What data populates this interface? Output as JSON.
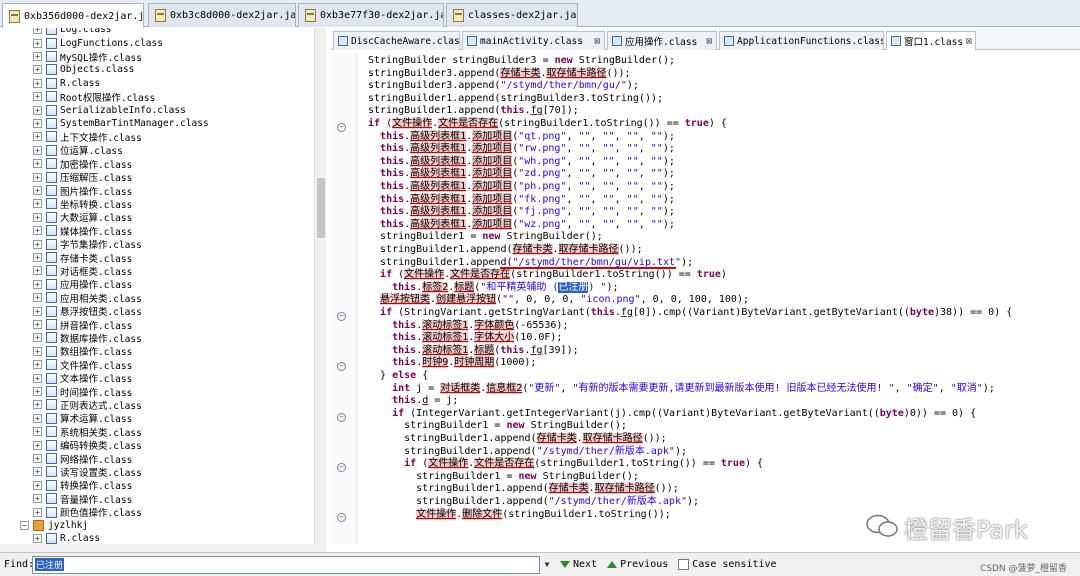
{
  "top_tabs": [
    {
      "label": "0xb356d000-dex2jar.jar",
      "active": true
    },
    {
      "label": "0xb3c8d000-dex2jar.jar",
      "active": false
    },
    {
      "label": "0xb3e77f30-dex2jar.jar",
      "active": false
    },
    {
      "label": "classes-dex2jar.jar",
      "active": false
    }
  ],
  "tree": {
    "items": [
      {
        "label": "Log.class",
        "type": "class",
        "indent": 1
      },
      {
        "label": "LogFunctions.class",
        "type": "class",
        "indent": 1
      },
      {
        "label": "MySQL操作.class",
        "type": "class",
        "indent": 1
      },
      {
        "label": "Objects.class",
        "type": "class",
        "indent": 1
      },
      {
        "label": "R.class",
        "type": "class",
        "indent": 1
      },
      {
        "label": "Root权限操作.class",
        "type": "class",
        "indent": 1
      },
      {
        "label": "SerializableInfo.class",
        "type": "class",
        "indent": 1
      },
      {
        "label": "SystemBarTintManager.class",
        "type": "class",
        "indent": 1
      },
      {
        "label": "上下文操作.class",
        "type": "class",
        "indent": 1
      },
      {
        "label": "位运算.class",
        "type": "class",
        "indent": 1
      },
      {
        "label": "加密操作.class",
        "type": "class",
        "indent": 1
      },
      {
        "label": "压缩解压.class",
        "type": "class",
        "indent": 1
      },
      {
        "label": "图片操作.class",
        "type": "class",
        "indent": 1
      },
      {
        "label": "坐标转换.class",
        "type": "class",
        "indent": 1
      },
      {
        "label": "大数运算.class",
        "type": "class",
        "indent": 1
      },
      {
        "label": "媒体操作.class",
        "type": "class",
        "indent": 1
      },
      {
        "label": "字节集操作.class",
        "type": "class",
        "indent": 1
      },
      {
        "label": "存储卡类.class",
        "type": "class",
        "indent": 1
      },
      {
        "label": "对话框类.class",
        "type": "class",
        "indent": 1
      },
      {
        "label": "应用操作.class",
        "type": "class",
        "indent": 1
      },
      {
        "label": "应用相关类.class",
        "type": "class",
        "indent": 1
      },
      {
        "label": "悬浮按钮类.class",
        "type": "class",
        "indent": 1
      },
      {
        "label": "拼音操作.class",
        "type": "class",
        "indent": 1
      },
      {
        "label": "数据库操作.class",
        "type": "class",
        "indent": 1
      },
      {
        "label": "数组操作.class",
        "type": "class",
        "indent": 1
      },
      {
        "label": "文件操作.class",
        "type": "class",
        "indent": 1
      },
      {
        "label": "文本操作.class",
        "type": "class",
        "indent": 1
      },
      {
        "label": "时间操作.class",
        "type": "class",
        "indent": 1
      },
      {
        "label": "正则表达式.class",
        "type": "class",
        "indent": 1
      },
      {
        "label": "算术运算.class",
        "type": "class",
        "indent": 1
      },
      {
        "label": "系统相关类.class",
        "type": "class",
        "indent": 1
      },
      {
        "label": "编码转换类.class",
        "type": "class",
        "indent": 1
      },
      {
        "label": "网络操作.class",
        "type": "class",
        "indent": 1
      },
      {
        "label": "读写设置类.class",
        "type": "class",
        "indent": 1
      },
      {
        "label": "转换操作.class",
        "type": "class",
        "indent": 1
      },
      {
        "label": "音量操作.class",
        "type": "class",
        "indent": 1
      },
      {
        "label": "颜色值操作.class",
        "type": "class",
        "indent": 1
      },
      {
        "label": "jyzlhkj",
        "type": "package",
        "indent": 0
      },
      {
        "label": "R.class",
        "type": "class",
        "indent": 1
      }
    ]
  },
  "editor_tabs": [
    {
      "label": "DiscCacheAware.class",
      "active": false
    },
    {
      "label": "mainActivity.class",
      "active": false
    },
    {
      "label": "应用操作.class",
      "active": false
    },
    {
      "label": "ApplicationFunctions.class",
      "active": false
    },
    {
      "label": "窗口1.class",
      "active": true
    }
  ],
  "code_lines": [
    "StringBuilder stringBuilder3 = new StringBuilder();",
    "stringBuilder3.append(存储卡类.取存储卡路径());",
    "stringBuilder3.append(\"/stymd/ther/bmn/gu/\");",
    "stringBuilder1.append(stringBuilder3.toString());",
    "stringBuilder1.append(this.fg[70]);",
    "if (文件操作.文件是否存在(stringBuilder1.toString()) == true) {",
    "  this.高级列表框1.添加项目(\"qt.png\", \"\", \"\", \"\", \"\");",
    "  this.高级列表框1.添加项目(\"rw.png\", \"\", \"\", \"\", \"\");",
    "  this.高级列表框1.添加项目(\"wh.png\", \"\", \"\", \"\", \"\");",
    "  this.高级列表框1.添加项目(\"zd.png\", \"\", \"\", \"\", \"\");",
    "  this.高级列表框1.添加项目(\"ph.png\", \"\", \"\", \"\", \"\");",
    "  this.高级列表框1.添加项目(\"fk.png\", \"\", \"\", \"\", \"\");",
    "  this.高级列表框1.添加项目(\"fj.png\", \"\", \"\", \"\", \"\");",
    "  this.高级列表框1.添加项目(\"wz.png\", \"\", \"\", \"\", \"\");",
    "  stringBuilder1 = new StringBuilder();",
    "  stringBuilder1.append(存储卡类.取存储卡路径());",
    "  stringBuilder1.append(\"/stymd/ther/bmn/gu/vip.txt\");",
    "  if (文件操作.文件是否存在(stringBuilder1.toString()) == true)",
    "    this.标签2.标题(\"和平精英辅助 (已注册) \");",
    "  悬浮按钮类.创建悬浮按钮(\"\", 0, 0, 0, \"icon.png\", 0, 0, 100, 100);",
    "  if (StringVariant.getStringVariant(this.fg[0]).cmp((Variant)ByteVariant.getByteVariant((byte)38)) == 0) {",
    "    this.滚动标签1.字体颜色(-65536);",
    "    this.滚动标签1.字体大小(10.0F);",
    "    this.滚动标签1.标题(this.fg[39]);",
    "    this.时钟9.时钟周期(1000);",
    "  } else {",
    "    int j = 对话框类.信息框2(\"更新\", \"有新的版本需要更新,请更新到最新版本使用! 旧版本已经无法使用! \", \"确定\", \"取消\");",
    "    this.d = j;",
    "    if (IntegerVariant.getIntegerVariant(j).cmp((Variant)ByteVariant.getByteVariant((byte)0)) == 0) {",
    "      stringBuilder1 = new StringBuilder();",
    "      stringBuilder1.append(存储卡类.取存储卡路径());",
    "      stringBuilder1.append(\"/stymd/ther/新版本.apk\");",
    "      if (文件操作.文件是否存在(stringBuilder1.toString()) == true) {",
    "        stringBuilder1 = new StringBuilder();",
    "        stringBuilder1.append(存储卡类.取存储卡路径());",
    "        stringBuilder1.append(\"/stymd/ther/新版本.apk\");",
    "        文件操作.删除文件(stringBuilder1.toString());"
  ],
  "find_bar": {
    "label": "Find:",
    "value": "已注册",
    "next_label": "Next",
    "previous_label": "Previous",
    "case_label": "Case sensitive"
  },
  "watermark": {
    "main": "橙留香Park",
    "sub": "CSDN @菠萝_橙留香"
  }
}
